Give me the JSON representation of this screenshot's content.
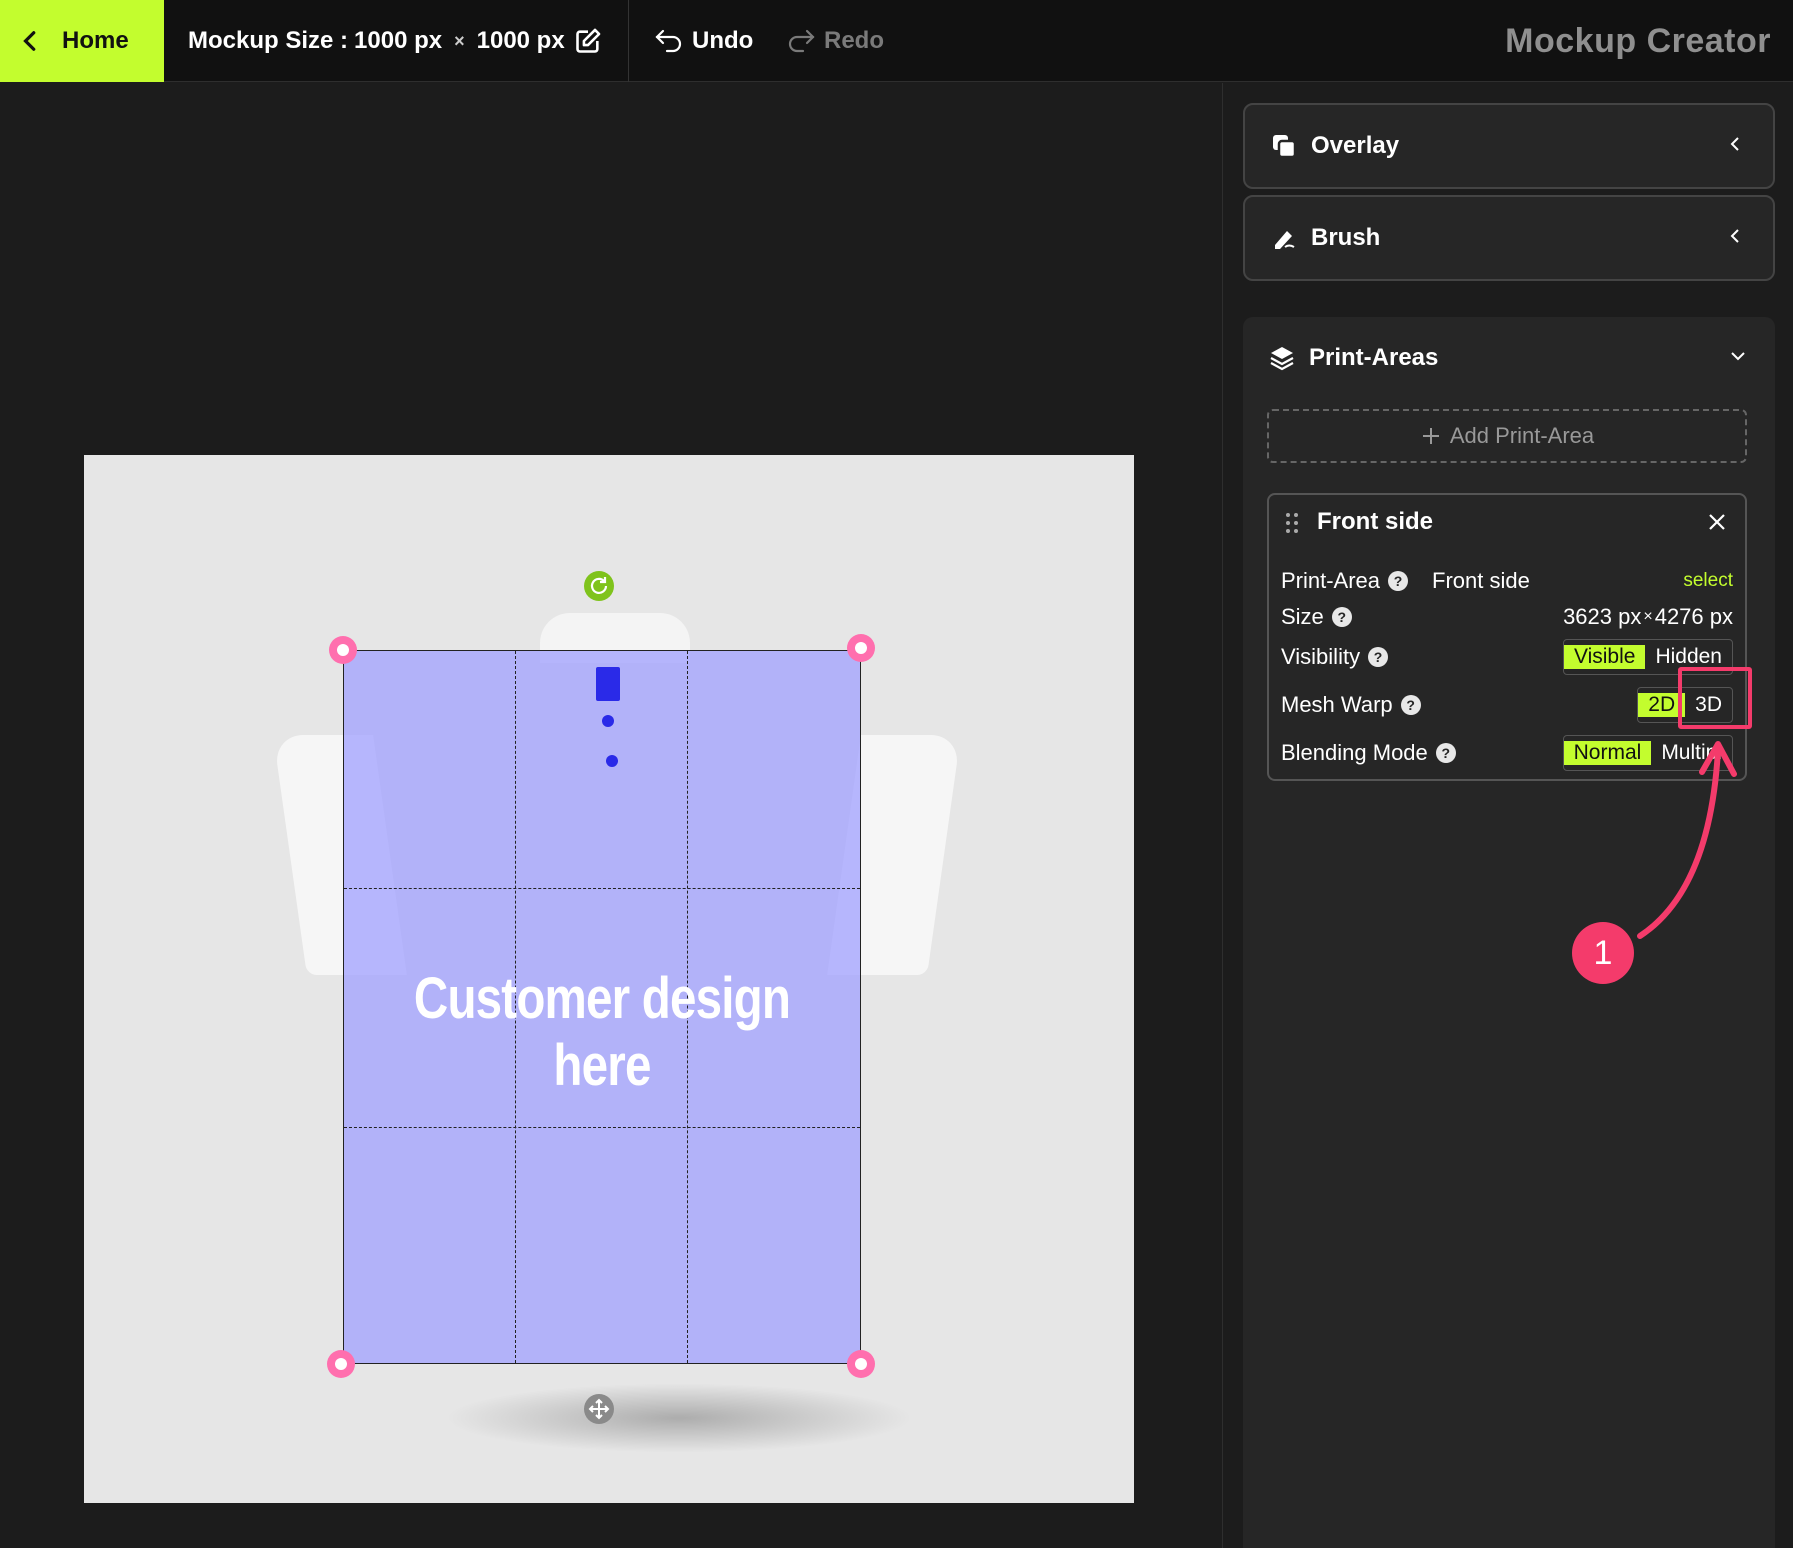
{
  "topbar": {
    "home_label": "Home",
    "mockup_size_label": "Mockup Size :",
    "width": "1000 px",
    "times": "×",
    "height": "1000 px",
    "undo_label": "Undo",
    "redo_label": "Redo",
    "app_title": "Mockup Creator"
  },
  "canvas": {
    "design_placeholder": "Customer design here"
  },
  "panel": {
    "overlay_label": "Overlay",
    "brush_label": "Brush",
    "print_areas_label": "Print-Areas",
    "add_print_area_label": "Add Print-Area",
    "card": {
      "title": "Front side",
      "print_area_label": "Print-Area",
      "print_area_value": "Front side",
      "select_label": "select",
      "size_label": "Size",
      "size_width": "3623 px",
      "size_times": "×",
      "size_height": "4276 px",
      "visibility_label": "Visibility",
      "visibility_options": [
        "Visible",
        "Hidden"
      ],
      "mesh_warp_label": "Mesh Warp",
      "mesh_warp_options": [
        "2D",
        "3D"
      ],
      "blending_label": "Blending Mode",
      "blending_options": [
        "Normal",
        "Multipl"
      ]
    }
  },
  "annotation": {
    "step_number": "1"
  },
  "colors": {
    "accent": "#c3fd2e",
    "annotation": "#f43b6b",
    "handle": "#ff6fae",
    "print_area_fill": "#a0a0ff"
  }
}
